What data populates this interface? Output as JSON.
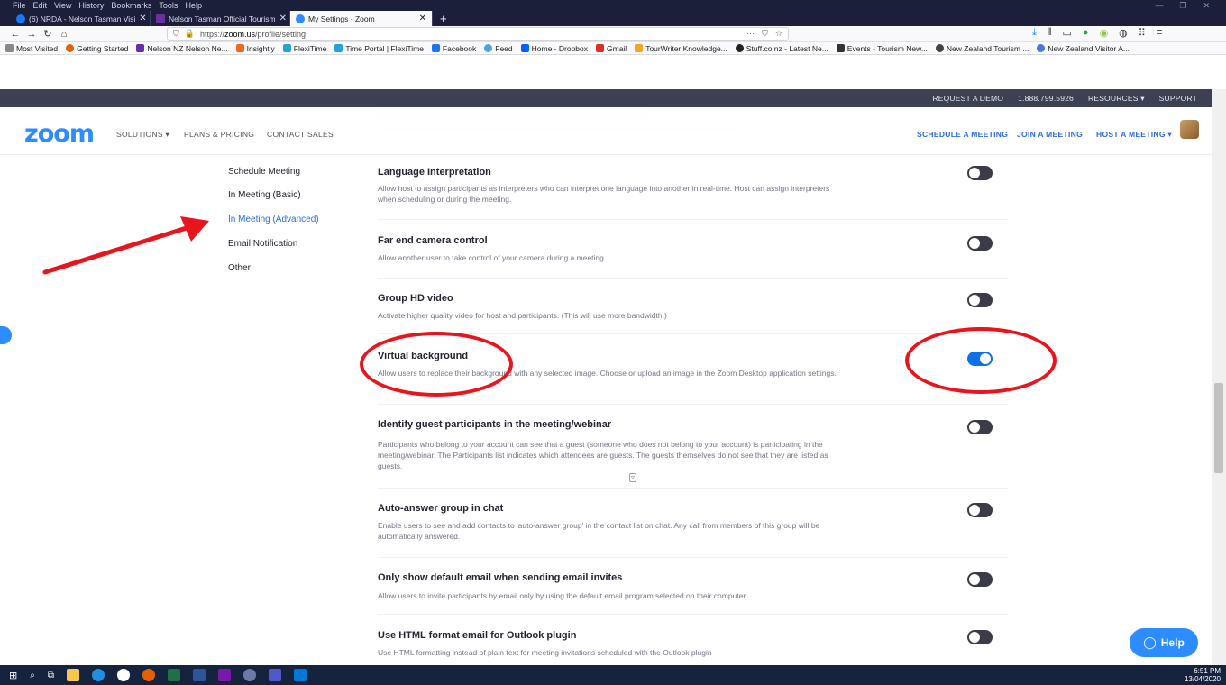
{
  "browser": {
    "menu": [
      "File",
      "Edit",
      "View",
      "History",
      "Bookmarks",
      "Tools",
      "Help"
    ],
    "tabs": [
      {
        "title": "(6) NRDA - Nelson Tasman Visi",
        "color": "#1877f2"
      },
      {
        "title": "Nelson Tasman Official Tourism",
        "color": "#6b2fa0"
      },
      {
        "title": "My Settings - Zoom",
        "color": "#2d8cff"
      }
    ],
    "url_scheme": "https://",
    "url_host": "zoom.us",
    "url_path": "/profile/setting",
    "bookmarks": [
      {
        "label": "Most Visited",
        "color": "#888"
      },
      {
        "label": "Getting Started",
        "color": "#e66000"
      },
      {
        "label": "Nelson NZ Nelson Ne...",
        "color": "#6b2fa0"
      },
      {
        "label": "Insightly",
        "color": "#f26722"
      },
      {
        "label": "FlexiTime",
        "color": "#28a0d8"
      },
      {
        "label": "Time Portal | FlexiTime",
        "color": "#28a0d8"
      },
      {
        "label": "Facebook",
        "color": "#1877f2"
      },
      {
        "label": "Feed",
        "color": "#4aa3df"
      },
      {
        "label": "Home - Dropbox",
        "color": "#0061ff"
      },
      {
        "label": "Gmail",
        "color": "#d93025"
      },
      {
        "label": "TourWriter Knowledge...",
        "color": "#f5a623"
      },
      {
        "label": "Stuff.co.nz - Latest Ne...",
        "color": "#222"
      },
      {
        "label": "Events - Tourism New...",
        "color": "#333"
      },
      {
        "label": "New Zealand Tourism ...",
        "color": "#444"
      },
      {
        "label": "New Zealand Visitor A...",
        "color": "#4a7bd0"
      }
    ]
  },
  "zoom": {
    "top_links": [
      "REQUEST A DEMO",
      "1.888.799.5926",
      "RESOURCES ▾",
      "SUPPORT"
    ],
    "logo": "zoom",
    "nav_left": [
      "SOLUTIONS ▾",
      "PLANS & PRICING",
      "CONTACT SALES"
    ],
    "nav_right": [
      "SCHEDULE A MEETING",
      "JOIN A MEETING",
      "HOST A MEETING ▾"
    ]
  },
  "sidebar": [
    "Schedule Meeting",
    "In Meeting (Basic)",
    "In Meeting (Advanced)",
    "Email Notification",
    "Other"
  ],
  "settings": [
    {
      "title": "Language Interpretation",
      "desc": "Allow host to assign participants as interpreters who can interpret one language into another in real-time. Host can assign interpreters when scheduling or during the meeting.",
      "on": false
    },
    {
      "title": "Far end camera control",
      "desc": "Allow another user to take control of your camera during a meeting",
      "on": false
    },
    {
      "title": "Group HD video",
      "desc": "Activate higher quality video for host and participants. (This will use more bandwidth.)",
      "on": false
    },
    {
      "title": "Virtual background",
      "desc": "Allow users to replace their background with any selected image. Choose or upload an image in the Zoom Desktop application settings.",
      "on": true
    },
    {
      "title": "Identify guest participants in the meeting/webinar",
      "desc": "Participants who belong to your account can see that a guest (someone who does not belong to your account) is participating in the meeting/webinar. The Participants list indicates which attendees are guests. The guests themselves do not see that they are listed as guests.",
      "on": false
    },
    {
      "title": "Auto-answer group in chat",
      "desc": "Enable users to see and add contacts to 'auto-answer group' in the contact list on chat. Any call from members of this group will be automatically answered.",
      "on": false
    },
    {
      "title": "Only show default email when sending email invites",
      "desc": "Allow users to invite participants by email only by using the default email program selected on their computer",
      "on": false
    },
    {
      "title": "Use HTML format email for Outlook plugin",
      "desc": "Use HTML formatting instead of plain text for meeting invitations scheduled with the Outlook plugin",
      "on": false
    }
  ],
  "help_label": "Help",
  "clock": {
    "time": "6:51 PM",
    "date": "13/04/2020"
  },
  "colors": {
    "accent": "#2d8cff",
    "toggle_on": "#0e71eb",
    "annotation": "#e8141e"
  }
}
